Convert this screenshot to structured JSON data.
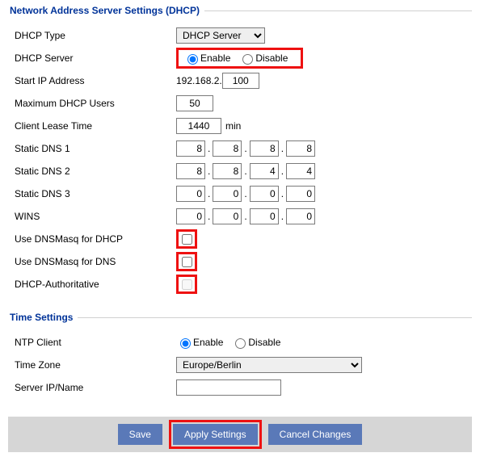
{
  "dhcp_section": {
    "legend": "Network Address Server Settings (DHCP)",
    "dhcp_type_label": "DHCP Type",
    "dhcp_type_selected": "DHCP Server",
    "dhcp_server_label": "DHCP Server",
    "enable_label": "Enable",
    "disable_label": "Disable",
    "start_ip_label": "Start IP Address",
    "start_ip_prefix": "192.168.2.",
    "start_ip_host": "100",
    "max_users_label": "Maximum DHCP Users",
    "max_users_value": "50",
    "lease_label": "Client Lease Time",
    "lease_value": "1440",
    "lease_unit": "min",
    "dns1_label": "Static DNS 1",
    "dns1": [
      "8",
      "8",
      "8",
      "8"
    ],
    "dns2_label": "Static DNS 2",
    "dns2": [
      "8",
      "8",
      "4",
      "4"
    ],
    "dns3_label": "Static DNS 3",
    "dns3": [
      "0",
      "0",
      "0",
      "0"
    ],
    "wins_label": "WINS",
    "wins": [
      "0",
      "0",
      "0",
      "0"
    ],
    "use_dnsmasq_dhcp_label": "Use DNSMasq for DHCP",
    "use_dnsmasq_dns_label": "Use DNSMasq for DNS",
    "dhcp_authoritative_label": "DHCP-Authoritative"
  },
  "time_section": {
    "legend": "Time Settings",
    "ntp_client_label": "NTP Client",
    "enable_label": "Enable",
    "disable_label": "Disable",
    "tz_label": "Time Zone",
    "tz_selected": "Europe/Berlin",
    "server_label": "Server IP/Name",
    "server_value": ""
  },
  "footer": {
    "save": "Save",
    "apply": "Apply Settings",
    "cancel": "Cancel Changes"
  }
}
